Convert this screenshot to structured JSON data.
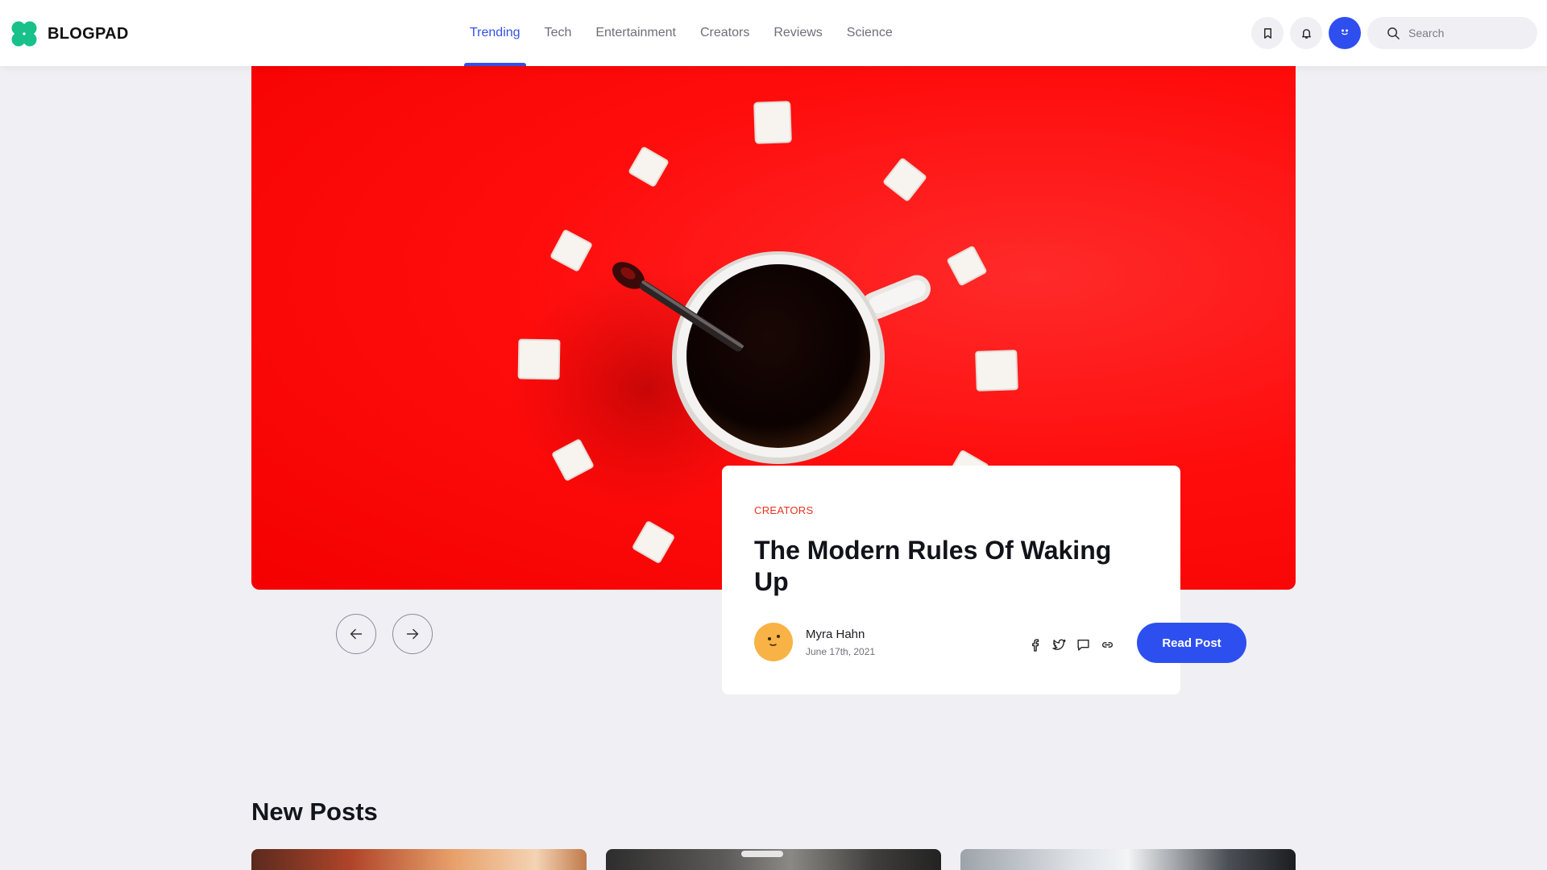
{
  "brand": {
    "name": "BLOGPAD",
    "color": "#18c08a"
  },
  "nav": {
    "items": [
      "Trending",
      "Tech",
      "Entertainment",
      "Creators",
      "Reviews",
      "Science"
    ],
    "active": "Trending"
  },
  "header": {
    "icons": [
      "bookmark-icon",
      "bell-icon"
    ],
    "search_placeholder": "Search"
  },
  "hero": {
    "image_subject": "coffee cup with sugar cubes on red background",
    "background_color": "#ff0d0d"
  },
  "featured": {
    "category": "CREATORS",
    "title": "The Modern Rules Of Waking Up",
    "author": "Myra Hahn",
    "date": "June 17th, 2021",
    "share_icons": [
      "facebook-icon",
      "twitter-icon",
      "comment-icon",
      "link-icon"
    ],
    "cta": "Read Post"
  },
  "carousel": {
    "prev_icon": "arrow-left-icon",
    "next_icon": "arrow-right-icon"
  },
  "new_posts": {
    "title": "New Posts",
    "count_visible": 3
  },
  "colors": {
    "accent": "#2e4ff0",
    "category": "#e8321f",
    "avatar": "#f8b245"
  }
}
